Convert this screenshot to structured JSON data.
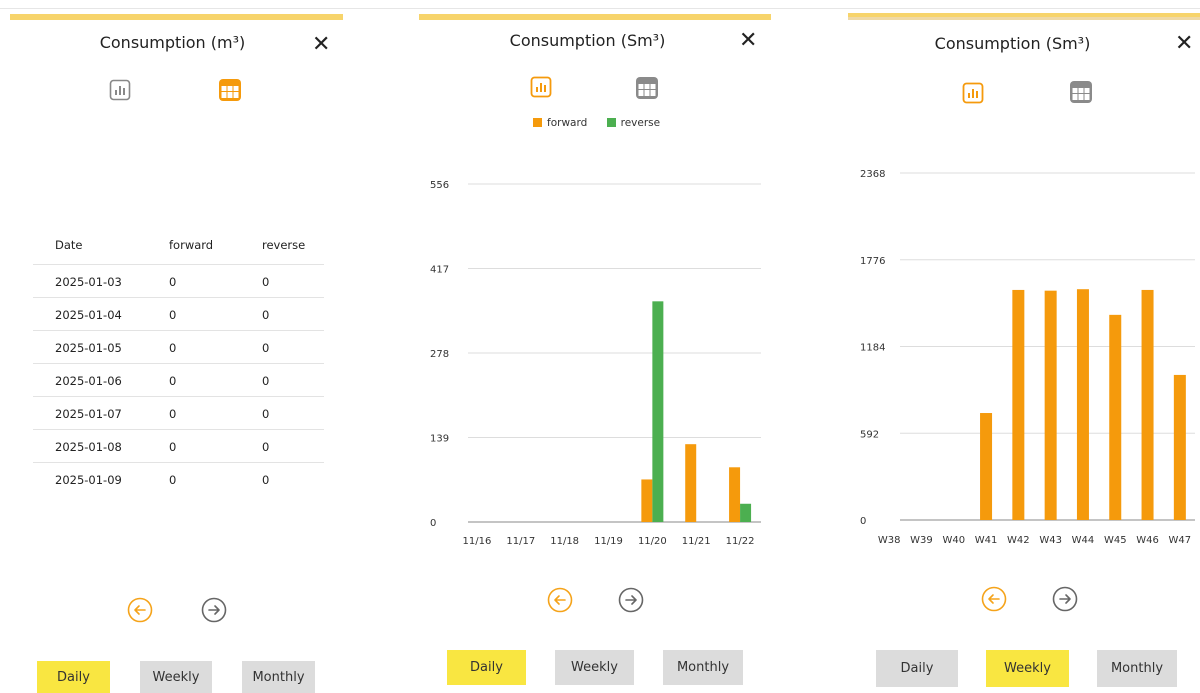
{
  "colors": {
    "accent": "#f7d46b",
    "orange": "#f59a0c",
    "green": "#4caf50",
    "active_tab": "#f9e641",
    "inactive_tab": "#dcdcdc",
    "grid": "#dddddd"
  },
  "panel1": {
    "title": "Consumption (m³)",
    "close_icon": "close-icon",
    "icons": {
      "chart": "bar-chart-icon",
      "table": "table-icon"
    },
    "table": {
      "headers": [
        "Date",
        "forward",
        "reverse"
      ],
      "rows": [
        [
          "2025-01-03",
          "0",
          "0"
        ],
        [
          "2025-01-04",
          "0",
          "0"
        ],
        [
          "2025-01-05",
          "0",
          "0"
        ],
        [
          "2025-01-06",
          "0",
          "0"
        ],
        [
          "2025-01-07",
          "0",
          "0"
        ],
        [
          "2025-01-08",
          "0",
          "0"
        ],
        [
          "2025-01-09",
          "0",
          "0"
        ]
      ]
    },
    "tabs": {
      "daily": "Daily",
      "weekly": "Weekly",
      "monthly": "Monthly",
      "active": "Daily"
    }
  },
  "panel2": {
    "title": "Consumption (Sm³)",
    "legend": {
      "forward": "forward",
      "reverse": "reverse"
    },
    "tabs": {
      "daily": "Daily",
      "weekly": "Weekly",
      "monthly": "Monthly",
      "active": "Daily"
    }
  },
  "panel3": {
    "title": "Consumption (Sm³)",
    "tabs": {
      "daily": "Daily",
      "weekly": "Weekly",
      "monthly": "Monthly",
      "active": "Weekly"
    }
  },
  "chart_data": [
    {
      "type": "bar",
      "categories": [
        "11/16",
        "11/17",
        "11/18",
        "11/19",
        "11/20",
        "11/21",
        "11/22"
      ],
      "series": [
        {
          "name": "forward",
          "values": [
            0,
            0,
            0,
            0,
            70,
            128,
            90
          ]
        },
        {
          "name": "reverse",
          "values": [
            0,
            0,
            0,
            0,
            363,
            0,
            30
          ]
        }
      ],
      "yticks": [
        0,
        139,
        278,
        417,
        556
      ],
      "ylim": [
        0,
        556
      ],
      "grid": true,
      "legend": "top-center"
    },
    {
      "type": "bar",
      "categories": [
        "W38",
        "W39",
        "W40",
        "W41",
        "W42",
        "W43",
        "W44",
        "W45",
        "W46",
        "W47"
      ],
      "series": [
        {
          "values": [
            0,
            0,
            0,
            730,
            1570,
            1565,
            1575,
            1400,
            1570,
            990
          ]
        }
      ],
      "yticks": [
        0,
        592,
        1184,
        1776,
        2368
      ],
      "ylim": [
        0,
        2368
      ],
      "grid": true
    }
  ]
}
